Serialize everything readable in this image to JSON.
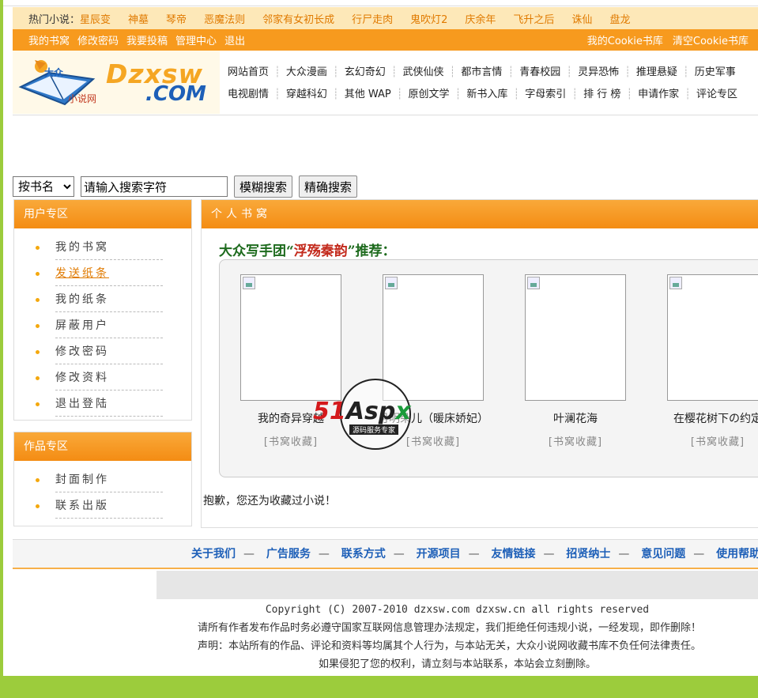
{
  "hot": {
    "label": "热门小说：",
    "items": [
      "星辰变",
      "神墓",
      "琴帝",
      "恶魔法则",
      "邻家有女初长成",
      "行尸走肉",
      "鬼吹灯2",
      "庆余年",
      "飞升之后",
      "诛仙",
      "盘龙"
    ]
  },
  "nav": {
    "left": [
      "我的书窝",
      "修改密码",
      "我要投稿",
      "管理中心",
      "退出"
    ],
    "right": [
      "我的Cookie书库",
      "清空Cookie书库"
    ]
  },
  "logo": {
    "brand": "Dzxsw",
    "brand_suffix": ".COM",
    "sub": "小说网",
    "badge": "大众"
  },
  "menu": {
    "row1": [
      "网站首页",
      "大众漫画",
      "玄幻奇幻",
      "武侠仙侠",
      "都市言情",
      "青春校园",
      "灵异恐怖",
      "推理悬疑",
      "历史军事"
    ],
    "row2": [
      "电视剧情",
      "穿越科幻",
      "其他 WAP",
      "原创文学",
      "新书入库",
      "字母索引",
      "排 行 榜",
      "申请作家",
      "评论专区"
    ]
  },
  "search": {
    "select_value": "按书名",
    "input_value": "请输入搜索字符",
    "fuzzy_label": "模糊搜索",
    "exact_label": "精确搜索"
  },
  "user_box": {
    "title": "用户专区",
    "items": [
      "我的书窝",
      "发送纸条",
      "我的纸条",
      "屏蔽用户",
      "修改密码",
      "修改资料",
      "退出登陆"
    ]
  },
  "works_box": {
    "title": "作品专区",
    "items": [
      "封面制作",
      "联系出版"
    ]
  },
  "main": {
    "title": "个人书窝",
    "recommend_prefix": "大众写手团“",
    "recommend_name": "浮殇秦韵",
    "recommend_suffix": "”推荐：",
    "books": [
      {
        "title": "我的奇异穿越",
        "collect": "[书窝收藏]"
      },
      {
        "title": "月明朵儿（暖床娇妃）",
        "collect": "[书窝收藏]"
      },
      {
        "title": "叶澜花海",
        "collect": "[书窝收藏]"
      },
      {
        "title": "在樱花树下の约定",
        "collect": "[书窝收藏]"
      }
    ],
    "notice": "抱歉，您还为收藏过小说！"
  },
  "watermark": {
    "red": "51",
    "black": "Asp",
    "green": "x",
    "tag": "源码服务专家"
  },
  "footer": {
    "links": [
      "关于我们",
      "广告服务",
      "联系方式",
      "开源项目",
      "友情链接",
      "招贤纳士",
      "意见问题",
      "使用帮助"
    ],
    "separator": "—",
    "copyright": "Copyright (C) 2007-2010 dzxsw.com dzxsw.cn all rights reserved",
    "line2": "请所有作者发布作品时务必遵守国家互联网信息管理办法规定，我们拒绝任何违规小说，一经发现，即作删除！",
    "line3": "声明：本站所有的作品、评论和资料等均属其个人行为，与本站无关，大众小说网收藏书库不负任何法律责任。",
    "line4": "如果侵犯了您的权利，请立刻与本站联系，本站会立刻删除。"
  },
  "colors": {
    "orange": "#f79a1e",
    "green_bg": "#9ccc3c",
    "link_blue": "#1d5fb8"
  }
}
